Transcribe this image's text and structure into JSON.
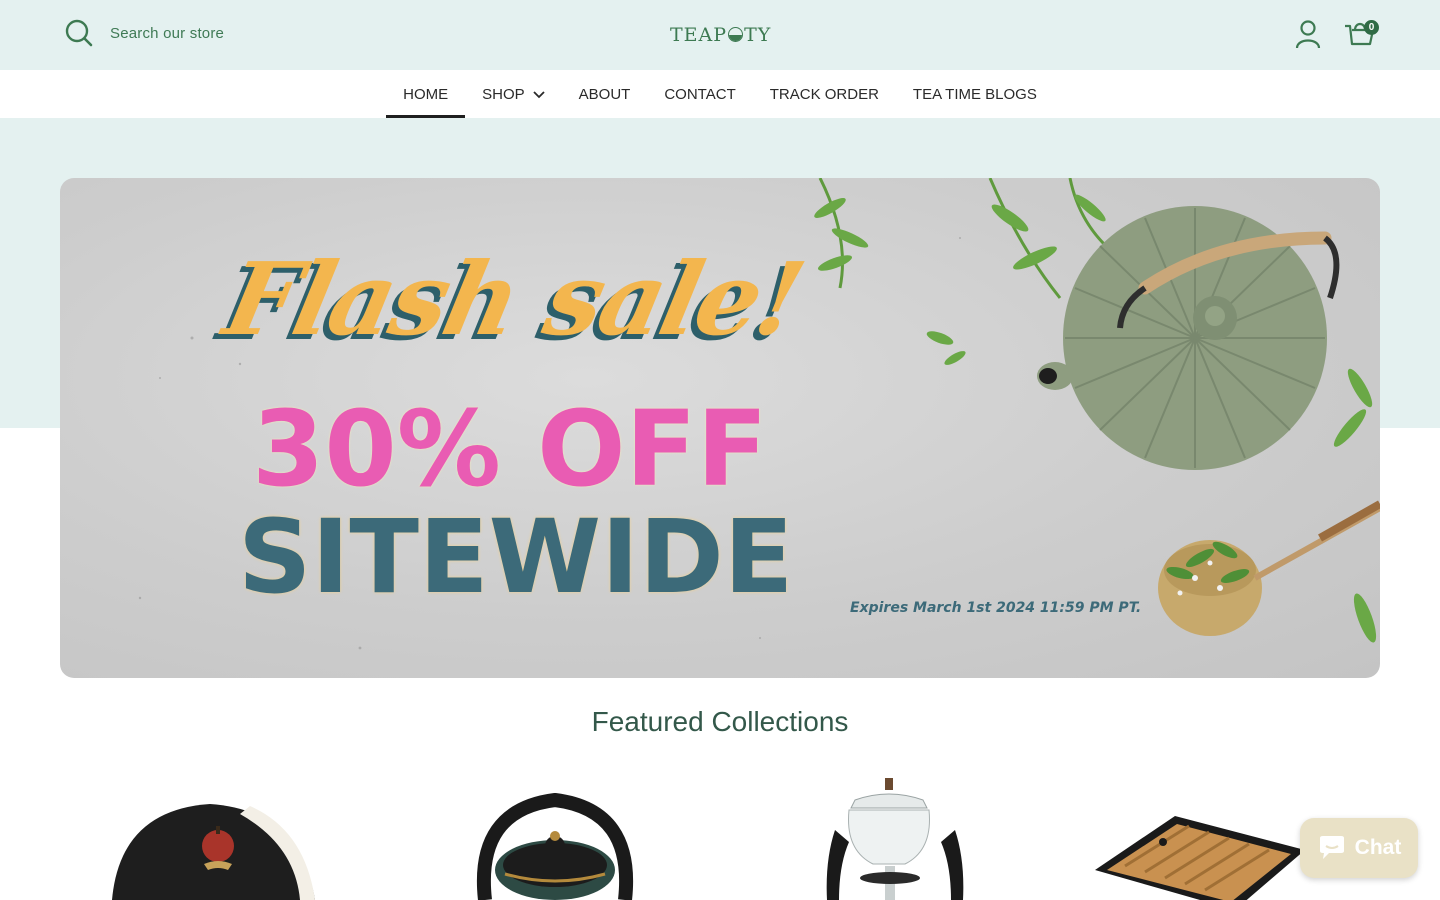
{
  "header": {
    "search_placeholder": "Search our store",
    "logo_text_left": "TEAP",
    "logo_text_right": "TY",
    "cart_count": "0",
    "icons": [
      "search-icon",
      "account-icon",
      "cart-icon"
    ]
  },
  "nav": {
    "items": [
      {
        "label": "HOME",
        "active": true
      },
      {
        "label": "SHOP",
        "has_dropdown": true
      },
      {
        "label": "ABOUT"
      },
      {
        "label": "CONTACT"
      },
      {
        "label": "TRACK ORDER"
      },
      {
        "label": "TEA TIME BLOGS"
      }
    ]
  },
  "hero": {
    "headline": "Flash sale!",
    "discount": "30% OFF",
    "scope": "SITEWIDE",
    "expiry": "Expires March 1st 2024 11:59 PM PT."
  },
  "featured": {
    "title": "Featured Collections"
  },
  "chat": {
    "label": "Chat"
  },
  "colors": {
    "accent_green": "#3d7a52",
    "header_bg": "#e4f1f0",
    "flash_yellow": "#f3b64e",
    "discount_pink": "#e95cb3",
    "sitewide_teal": "#3c6a79",
    "chat_bg": "#e9e1c6"
  }
}
